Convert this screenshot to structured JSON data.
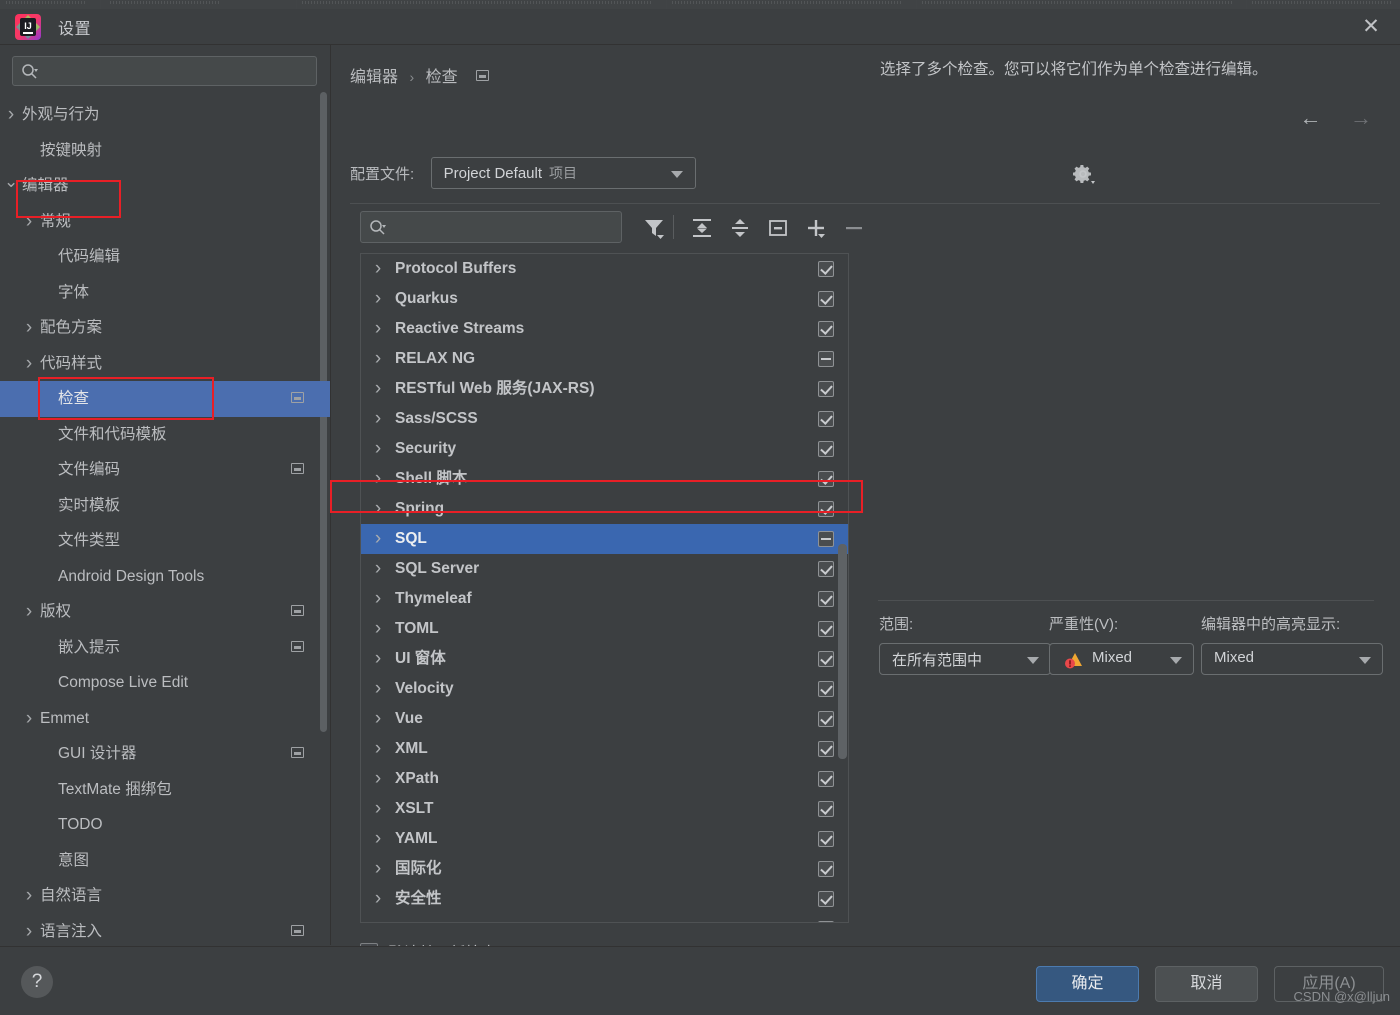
{
  "window": {
    "title": "设置",
    "close_icon": "close-icon",
    "app_icon": "intellij-idea-logo"
  },
  "sidebar": {
    "search_placeholder": "",
    "search_icon": "search-icon",
    "items": [
      {
        "label": "外观与行为",
        "arrow": ">",
        "indent": 0,
        "selected": false,
        "badge": false
      },
      {
        "label": "按键映射",
        "arrow": "",
        "indent": 1,
        "selected": false,
        "badge": false
      },
      {
        "label": "编辑器",
        "arrow": "∨",
        "indent": 0,
        "selected": false,
        "badge": false
      },
      {
        "label": "常规",
        "arrow": ">",
        "indent": 1,
        "selected": false,
        "badge": false
      },
      {
        "label": "代码编辑",
        "arrow": "",
        "indent": 2,
        "selected": false,
        "badge": false
      },
      {
        "label": "字体",
        "arrow": "",
        "indent": 2,
        "selected": false,
        "badge": false
      },
      {
        "label": "配色方案",
        "arrow": ">",
        "indent": 1,
        "selected": false,
        "badge": false
      },
      {
        "label": "代码样式",
        "arrow": ">",
        "indent": 1,
        "selected": false,
        "badge": false
      },
      {
        "label": "检查",
        "arrow": "",
        "indent": 2,
        "selected": true,
        "badge": true
      },
      {
        "label": "文件和代码模板",
        "arrow": "",
        "indent": 2,
        "selected": false,
        "badge": false
      },
      {
        "label": "文件编码",
        "arrow": "",
        "indent": 2,
        "selected": false,
        "badge": true
      },
      {
        "label": "实时模板",
        "arrow": "",
        "indent": 2,
        "selected": false,
        "badge": false
      },
      {
        "label": "文件类型",
        "arrow": "",
        "indent": 2,
        "selected": false,
        "badge": false
      },
      {
        "label": "Android Design Tools",
        "arrow": "",
        "indent": 2,
        "selected": false,
        "badge": false
      },
      {
        "label": "版权",
        "arrow": ">",
        "indent": 1,
        "selected": false,
        "badge": true
      },
      {
        "label": "嵌入提示",
        "arrow": "",
        "indent": 2,
        "selected": false,
        "badge": true
      },
      {
        "label": "Compose Live Edit",
        "arrow": "",
        "indent": 2,
        "selected": false,
        "badge": false
      },
      {
        "label": "Emmet",
        "arrow": ">",
        "indent": 1,
        "selected": false,
        "badge": false
      },
      {
        "label": "GUI 设计器",
        "arrow": "",
        "indent": 2,
        "selected": false,
        "badge": true
      },
      {
        "label": "TextMate 捆绑包",
        "arrow": "",
        "indent": 2,
        "selected": false,
        "badge": false
      },
      {
        "label": "TODO",
        "arrow": "",
        "indent": 2,
        "selected": false,
        "badge": false
      },
      {
        "label": "意图",
        "arrow": "",
        "indent": 2,
        "selected": false,
        "badge": false
      },
      {
        "label": "自然语言",
        "arrow": ">",
        "indent": 1,
        "selected": false,
        "badge": false
      },
      {
        "label": "语言注入",
        "arrow": ">",
        "indent": 1,
        "selected": false,
        "badge": true
      }
    ]
  },
  "breadcrumb": {
    "parent": "编辑器",
    "separator": "›",
    "current": "检查"
  },
  "nav": {
    "back_icon": "arrow-left-icon",
    "forward_icon": "arrow-right-icon"
  },
  "profile": {
    "label": "配置文件:",
    "value": "Project Default",
    "scope_suffix": "项目",
    "gear_icon": "gear-icon"
  },
  "list_toolbar": {
    "search_placeholder": "",
    "search_icon": "search-icon",
    "buttons": [
      {
        "name": "filter-icon",
        "title": "筛选"
      },
      {
        "name": "expand-all-icon",
        "title": "全部展开"
      },
      {
        "name": "collapse-all-icon",
        "title": "全部折叠"
      },
      {
        "name": "reset-icon",
        "title": "重置"
      },
      {
        "name": "add-icon",
        "title": "添加"
      },
      {
        "name": "remove-icon",
        "title": "移除"
      }
    ]
  },
  "inspections": [
    {
      "label": "Protocol Buffers",
      "state": "checked"
    },
    {
      "label": "Quarkus",
      "state": "checked"
    },
    {
      "label": "Reactive Streams",
      "state": "checked"
    },
    {
      "label": "RELAX NG",
      "state": "partial"
    },
    {
      "label": "RESTful Web 服务(JAX-RS)",
      "state": "checked"
    },
    {
      "label": "Sass/SCSS",
      "state": "checked"
    },
    {
      "label": "Security",
      "state": "checked"
    },
    {
      "label": "Shell 脚本",
      "state": "checked"
    },
    {
      "label": "Spring",
      "state": "checked"
    },
    {
      "label": "SQL",
      "state": "partial",
      "selected": true
    },
    {
      "label": "SQL Server",
      "state": "checked"
    },
    {
      "label": "Thymeleaf",
      "state": "checked"
    },
    {
      "label": "TOML",
      "state": "checked"
    },
    {
      "label": "UI 窗体",
      "state": "checked"
    },
    {
      "label": "Velocity",
      "state": "checked"
    },
    {
      "label": "Vue",
      "state": "checked"
    },
    {
      "label": "XML",
      "state": "checked"
    },
    {
      "label": "XPath",
      "state": "checked"
    },
    {
      "label": "XSLT",
      "state": "checked"
    },
    {
      "label": "YAML",
      "state": "checked"
    },
    {
      "label": "国际化",
      "state": "checked"
    },
    {
      "label": "安全性",
      "state": "checked"
    },
    {
      "label": "",
      "state": "checked"
    }
  ],
  "new_inspections_checkbox": {
    "label": "默认禁用新检查",
    "checked": false
  },
  "detail": {
    "message": "选择了多个检查。您可以将它们作为单个检查进行编辑。",
    "scope": {
      "label": "范围:",
      "value": "在所有范围中"
    },
    "severity": {
      "label": "严重性(V):",
      "value": "Mixed",
      "icon": "warning-error-icon"
    },
    "highlight": {
      "label": "编辑器中的高亮显示:",
      "value": "Mixed"
    }
  },
  "footer": {
    "help_label": "?",
    "ok_label": "确定",
    "cancel_label": "取消",
    "apply_label": "应用(A)",
    "watermark": "CSDN @x@lljun"
  },
  "colors": {
    "accent_blue": "#4b6eaf",
    "row_selected": "#3a67b0",
    "annotation_red": "#e81f26",
    "panel_bg": "#3c3f41",
    "primary_button": "#365880"
  }
}
